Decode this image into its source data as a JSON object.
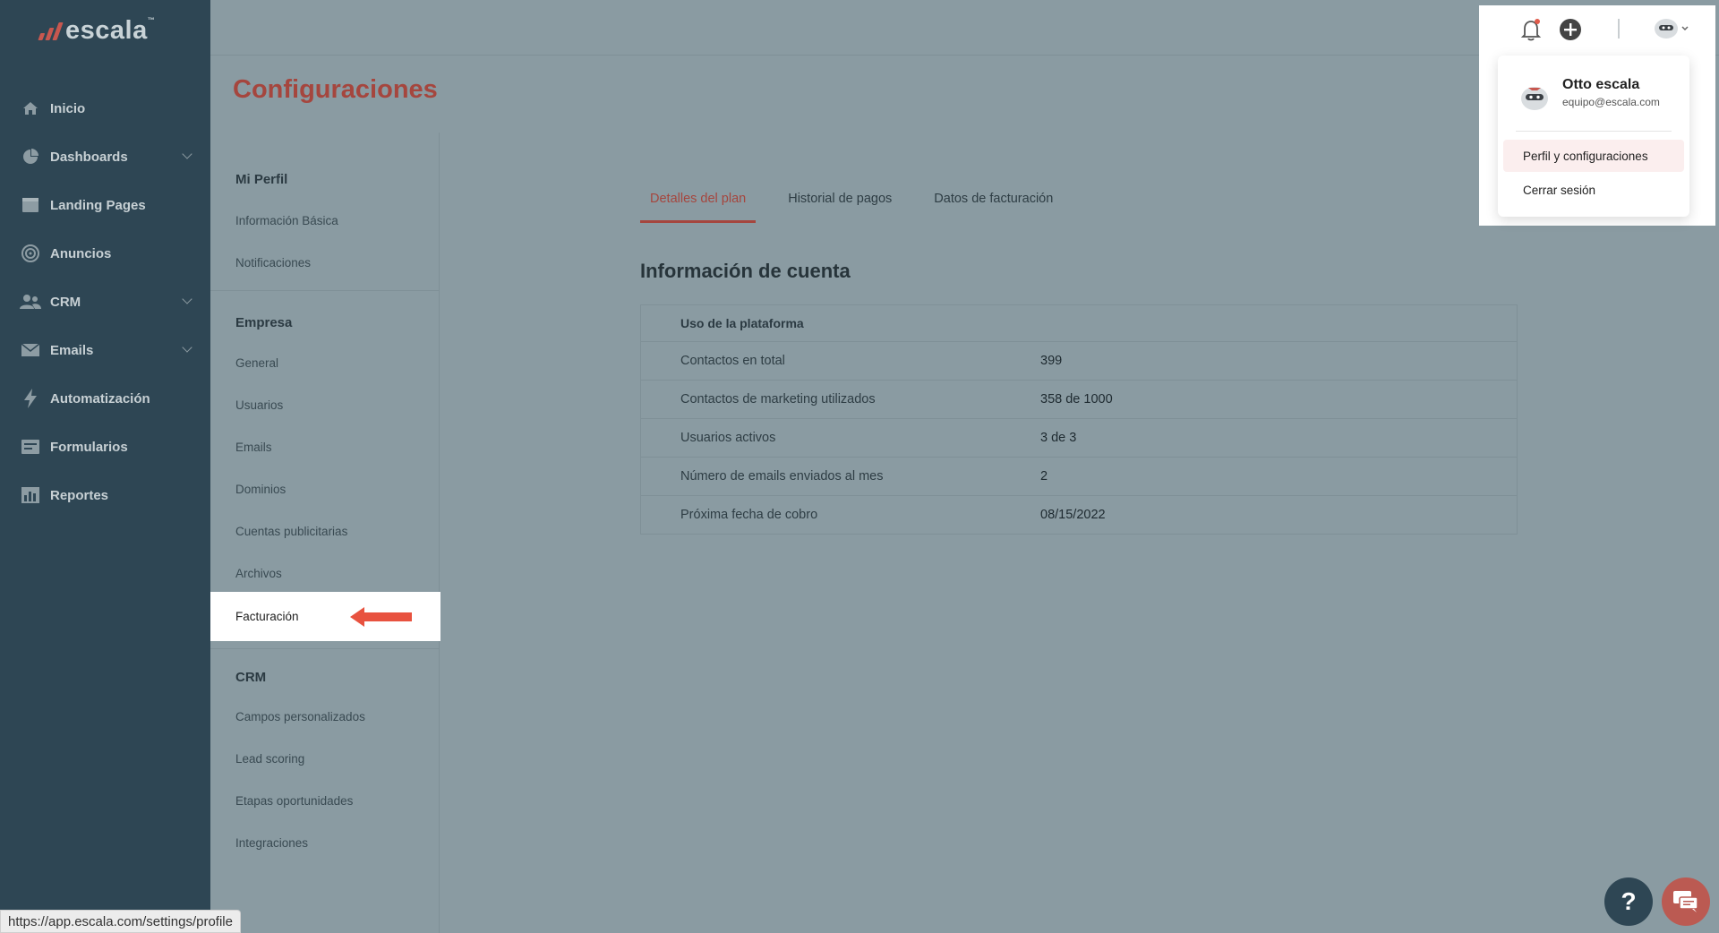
{
  "app": {
    "logo_text": "escala",
    "logo_tm": "™"
  },
  "sidebar": {
    "items": [
      {
        "label": "Inicio",
        "icon": "home-icon"
      },
      {
        "label": "Dashboards",
        "icon": "pie-chart-icon",
        "expandable": true
      },
      {
        "label": "Landing Pages",
        "icon": "window-icon"
      },
      {
        "label": "Anuncios",
        "icon": "target-icon"
      },
      {
        "label": "CRM",
        "icon": "people-icon",
        "expandable": true
      },
      {
        "label": "Emails",
        "icon": "mail-icon",
        "expandable": true
      },
      {
        "label": "Automatización",
        "icon": "lightning-icon"
      },
      {
        "label": "Formularios",
        "icon": "form-icon"
      },
      {
        "label": "Reportes",
        "icon": "bar-chart-icon"
      }
    ]
  },
  "page": {
    "title": "Configuraciones"
  },
  "settings_menu": {
    "sections": [
      {
        "title": "Mi Perfil",
        "items": [
          "Información Básica",
          "Notificaciones"
        ]
      },
      {
        "title": "Empresa",
        "items": [
          "General",
          "Usuarios",
          "Emails",
          "Dominios",
          "Cuentas publicitarias",
          "Archivos",
          "Facturación"
        ]
      },
      {
        "title": "CRM",
        "items": [
          "Campos personalizados",
          "Lead scoring",
          "Etapas oportunidades",
          "Integraciones"
        ]
      }
    ],
    "active_item": "Facturación"
  },
  "tabs": [
    {
      "label": "Detalles del plan",
      "active": true
    },
    {
      "label": "Historial de pagos",
      "active": false
    },
    {
      "label": "Datos de facturación",
      "active": false
    }
  ],
  "account": {
    "title": "Información de cuenta",
    "section_header": "Uso de la plataforma",
    "rows": [
      {
        "label": "Contactos en total",
        "value": "399"
      },
      {
        "label": "Contactos de marketing utilizados",
        "value": "358 de 1000"
      },
      {
        "label": "Usuarios activos",
        "value": "3 de 3"
      },
      {
        "label": "Número de emails enviados al mes",
        "value": "2"
      },
      {
        "label": "Próxima fecha de cobro",
        "value": "08/15/2022"
      }
    ]
  },
  "user_menu": {
    "name": "Otto escala",
    "email": "equipo@escala.com",
    "items": [
      {
        "label": "Perfil y configuraciones",
        "highlighted": true
      },
      {
        "label": "Cerrar sesión",
        "highlighted": false
      }
    ]
  },
  "header_icons": [
    "bell-icon",
    "plus-circle-icon",
    "avatar"
  ],
  "floating": {
    "help_label": "?"
  },
  "status_bar": {
    "url": "https://app.escala.com/settings/profile"
  },
  "colors": {
    "sidebar": "#2e4654",
    "accent": "#a5463e",
    "overlay_bg": "#8a9ba2",
    "arrow": "#e8523f"
  }
}
